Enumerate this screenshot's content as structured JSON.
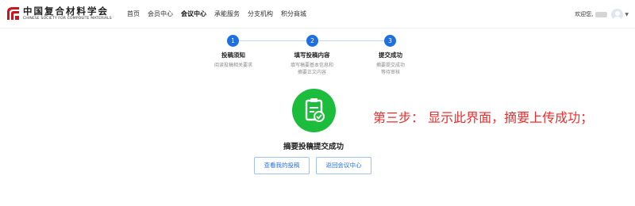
{
  "header": {
    "logo_cn": "中国复合材料学会",
    "logo_en": "CHINESE SOCIETY FOR COMPOSITE MATERIALS",
    "nav": [
      "首页",
      "会员中心",
      "会议中心",
      "承能服务",
      "分支机构",
      "积分商城"
    ],
    "active_nav": "会议中心",
    "welcome": "欢迎您,"
  },
  "steps": [
    {
      "num": "1",
      "title": "投稿须知",
      "desc": [
        "阅读投稿相关要求"
      ]
    },
    {
      "num": "2",
      "title": "填写投稿内容",
      "desc": [
        "填写稿要基本信息和",
        "摘要正文内容"
      ]
    },
    {
      "num": "3",
      "title": "提交成功",
      "desc": [
        "摘要提交成功",
        "等待审核"
      ]
    }
  ],
  "success": {
    "message": "摘要投稿提交成功"
  },
  "annotation": "第三步： 显示此界面，摘要上传成功；",
  "buttons": {
    "view": "查看我的投稿",
    "back": "返回会议中心"
  },
  "colors": {
    "accent": "#1e6fe0",
    "success": "#1cbc3c",
    "annotation": "#ee2b2b"
  }
}
